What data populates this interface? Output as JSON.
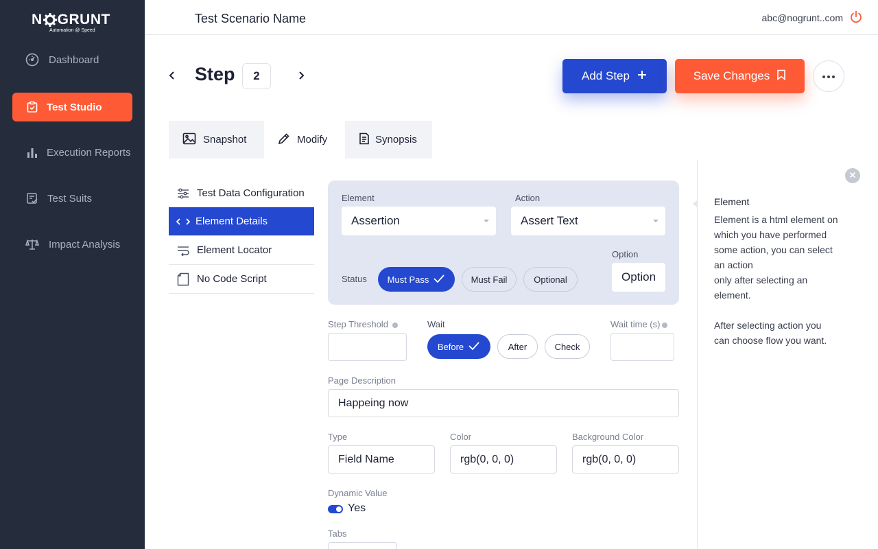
{
  "brand": {
    "logo_text_left": "N",
    "logo_text_right": "GRUNT",
    "tagline": "Automation @ Speed",
    "accent": "#fe5a35",
    "primary": "#2448d0",
    "sidebar_bg": "#252d3d"
  },
  "sidebar": {
    "items": [
      {
        "label": "Dashboard",
        "icon": "gauge-icon"
      },
      {
        "label": "Test Studio",
        "icon": "clipboard-icon",
        "active": true
      },
      {
        "label": "Execution Reports",
        "icon": "bar-chart-icon"
      },
      {
        "label": "Test Suits",
        "icon": "checklist-icon"
      },
      {
        "label": "Impact Analysis",
        "icon": "scale-icon"
      }
    ]
  },
  "header": {
    "scenario_title": "Test Scenario Name",
    "user_email": "abc@nogrunt..com"
  },
  "step": {
    "label": "Step",
    "number": "2"
  },
  "actions": {
    "add_step": "Add Step",
    "save_changes": "Save Changes"
  },
  "tabs": [
    {
      "label": "Snapshot",
      "icon": "image-icon"
    },
    {
      "label": "Modify",
      "icon": "pencil-icon",
      "active": true
    },
    {
      "label": "Synopsis",
      "icon": "document-icon"
    }
  ],
  "sub_nav": [
    {
      "label": "Test Data Configuration",
      "icon": "sliders-icon"
    },
    {
      "label": "Element Details",
      "icon": "code-icon",
      "active": true
    },
    {
      "label": "Element Locator",
      "icon": "wrap-icon"
    },
    {
      "label": "No Code Script",
      "icon": "page-icon"
    }
  ],
  "form": {
    "element_label": "Element",
    "element_value": "Assertion",
    "action_label": "Action",
    "action_value": "Assert Text",
    "status_label": "Status",
    "status_options": [
      "Must Pass",
      "Must Fail",
      "Optional"
    ],
    "status_selected": "Must Pass",
    "option_label": "Option",
    "option_value": "Option",
    "step_threshold_label": "Step Threshold",
    "step_threshold_value": "",
    "wait_label": "Wait",
    "wait_options": [
      "Before",
      "After",
      "Check"
    ],
    "wait_selected": "Before",
    "wait_time_label": "Wait time (s)",
    "wait_time_value": "",
    "page_description_label": "Page Description",
    "page_description_value": "Happeing now",
    "type_label": "Type",
    "type_value": "Field Name",
    "color_label": "Color",
    "color_value": "rgb(0, 0, 0)",
    "bg_color_label": "Background Color",
    "bg_color_value": "rgb(0, 0, 0)",
    "dynamic_value_label": "Dynamic Value",
    "dynamic_value_state": "Yes",
    "tabs_label": "Tabs"
  },
  "help": {
    "title": "Element",
    "line1": "Element is a html element on",
    "line2": "which you have performed",
    "line3": "some action, you can select",
    "line4": "an action",
    "line5": "only after selecting an",
    "line6": "element.",
    "line7": "After selecting action you",
    "line8": "can choose flow you want."
  }
}
